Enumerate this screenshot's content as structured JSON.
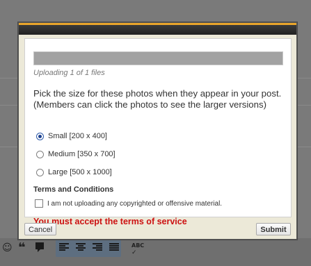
{
  "dialog": {
    "upload_progress": 1.0,
    "uploading_status": "Uploading 1 of 1 files",
    "prompt_line1": "Pick the size for these photos when they appear in your post.",
    "prompt_line2": "(Members can click the photos to see the larger versions)",
    "size_options": [
      {
        "label": "Small [200 x 400]",
        "selected": true
      },
      {
        "label": "Medium [350 x 700]",
        "selected": false
      },
      {
        "label": "Large [500 x 1000]",
        "selected": false
      }
    ],
    "terms_heading": "Terms and Conditions",
    "terms_checkbox_label": "I am not uploading any copyrighted or offensive material.",
    "terms_checked": false,
    "error_message": "You must accept the terms of service",
    "cancel_label": "Cancel",
    "submit_label": "Submit"
  },
  "toolbar": {
    "icons": [
      "smiley-icon",
      "quote-icon",
      "speech-bubble-icon",
      "align-left-icon",
      "align-center-icon",
      "align-right-icon",
      "align-justify-icon",
      "spellcheck-icon"
    ],
    "spellcheck_label": "ABC"
  },
  "colors": {
    "accent_stripe": "#e9a52b",
    "error": "#cc1111",
    "overlay": "#7a7a7a"
  }
}
